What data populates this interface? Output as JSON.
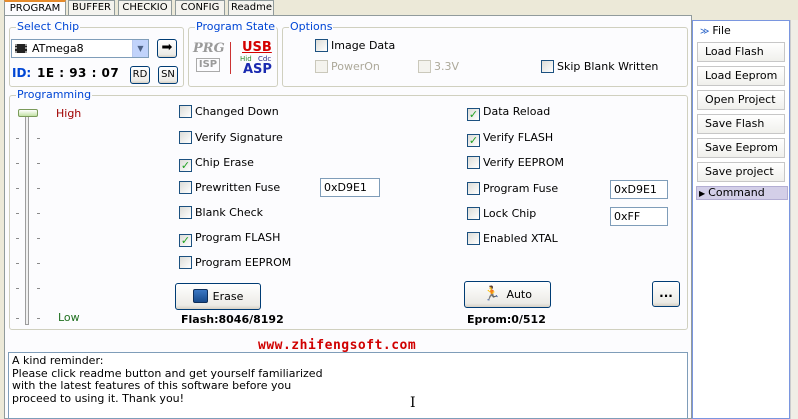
{
  "tabs": [
    "PROGRAM",
    "BUFFER",
    "CHECKIO",
    "CONFIG",
    "Readme"
  ],
  "select_chip": {
    "title": "Select Chip",
    "chip": "ATmega8",
    "id_label": "ID:",
    "id_value": "1E : 93 : 07",
    "rd_label": "RD",
    "sn_label": "SN"
  },
  "program_state": {
    "title": "Program State",
    "prg": "PRG",
    "isp": "ISP",
    "usb": "USB",
    "hid": "Hid",
    "cdc": "Cdc",
    "asp": "ASP"
  },
  "options": {
    "title": "Options",
    "image_data": "Image Data",
    "image_data_checked": false,
    "power_on": "PowerOn",
    "v33": "3.3V",
    "skip_blank": "Skip Blank Written",
    "skip_blank_checked": false
  },
  "programming": {
    "title": "Programming",
    "high": "High",
    "low": "Low",
    "slider_level": 1.0,
    "left_options": [
      {
        "label": "Changed Down",
        "checked": false
      },
      {
        "label": "Verify Signature",
        "checked": false
      },
      {
        "label": "Chip Erase",
        "checked": true
      },
      {
        "label": "Prewritten Fuse",
        "checked": false
      },
      {
        "label": "Blank Check",
        "checked": false
      },
      {
        "label": "Program FLASH",
        "checked": true
      },
      {
        "label": "Program EEPROM",
        "checked": false
      }
    ],
    "right_options": [
      {
        "label": "Data Reload",
        "checked": true
      },
      {
        "label": "Verify FLASH",
        "checked": true
      },
      {
        "label": "Verify EEPROM",
        "checked": false
      },
      {
        "label": "Program Fuse",
        "checked": false
      },
      {
        "label": "Lock Chip",
        "checked": false
      },
      {
        "label": "Enabled XTAL",
        "checked": false
      }
    ],
    "prewritten_fuse_value": "0xD9E1",
    "program_fuse_value": "0xD9E1",
    "lock_chip_value": "0xFF",
    "erase_label": "Erase",
    "auto_label": "Auto",
    "more_label": "...",
    "flash_status": "Flash:8046/8192",
    "eprom_status": "Eprom:0/512"
  },
  "watermark": "www.zhifengsoft.com",
  "reminder_text": "A kind reminder:\nPlease click readme button and get yourself familiarized\nwith the latest features of this software before you\nproceed to using it. Thank you!",
  "side_panel": {
    "file_header": "File",
    "buttons": [
      "Load Flash",
      "Load Eeprom",
      "Open Project",
      "Save Flash",
      "Save Eeprom",
      "Save project"
    ],
    "command_header": "Command"
  },
  "colors": {
    "group_title": "#0046d5",
    "high": "#a00000",
    "low": "#207020",
    "watermark": "#d00000",
    "check": "#21a121"
  }
}
